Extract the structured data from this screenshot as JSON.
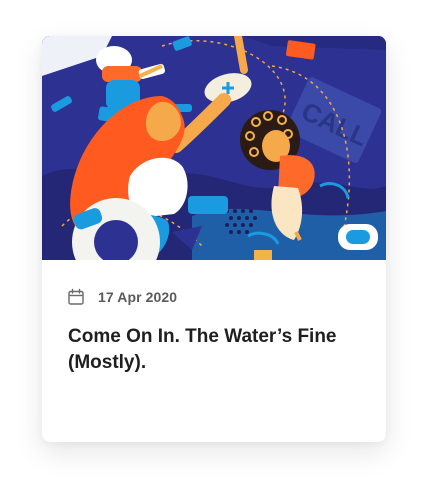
{
  "post": {
    "date": "17 Apr 2020",
    "title": "Come On In. The Water’s Fine (Mostly).",
    "date_icon": "calendar-icon",
    "illustration_text": "CALL"
  },
  "colors": {
    "illustration_bg": "#2d3192",
    "accent_blue": "#1a9be0",
    "accent_orange": "#ff5a1f",
    "title_text": "#1f1f1f",
    "date_text": "#5a5a5a"
  }
}
